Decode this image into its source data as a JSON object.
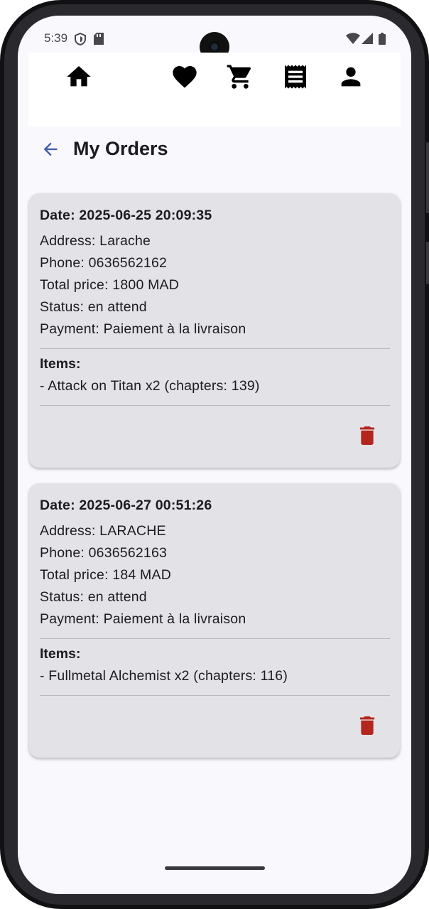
{
  "status_bar": {
    "time": "5:39",
    "icons": [
      "shield-icon",
      "sd-card-icon",
      "wifi-icon",
      "signal-icon",
      "battery-icon"
    ]
  },
  "top_nav": {
    "items": [
      "home-icon",
      "favorite-icon",
      "cart-icon",
      "receipt-icon",
      "profile-icon"
    ]
  },
  "app_bar": {
    "back_icon": "arrow-back-icon",
    "title": "My Orders"
  },
  "orders": [
    {
      "date": "Date: 2025-06-25 20:09:35",
      "address": "Address: Larache",
      "phone": "Phone: 0636562162",
      "total": "Total price: 1800 MAD",
      "status": "Status: en attend",
      "payment": "Payment: Paiement à la livraison",
      "items_title": "Items:",
      "items": [
        "- Attack on Titan x2 (chapters: 139)"
      ]
    },
    {
      "date": "Date: 2025-06-27 00:51:26",
      "address": "Address: LARACHE",
      "phone": "Phone: 0636562163",
      "total": "Total price: 184 MAD",
      "status": "Status: en attend",
      "payment": "Payment: Paiement à la livraison",
      "items_title": "Items:",
      "items": [
        "- Fullmetal Alchemist x2 (chapters: 116)"
      ]
    }
  ],
  "colors": {
    "background": "#f9f8fd",
    "card": "#e3e2e7",
    "delete": "#b3261e",
    "back_arrow": "#3f5aa8"
  }
}
